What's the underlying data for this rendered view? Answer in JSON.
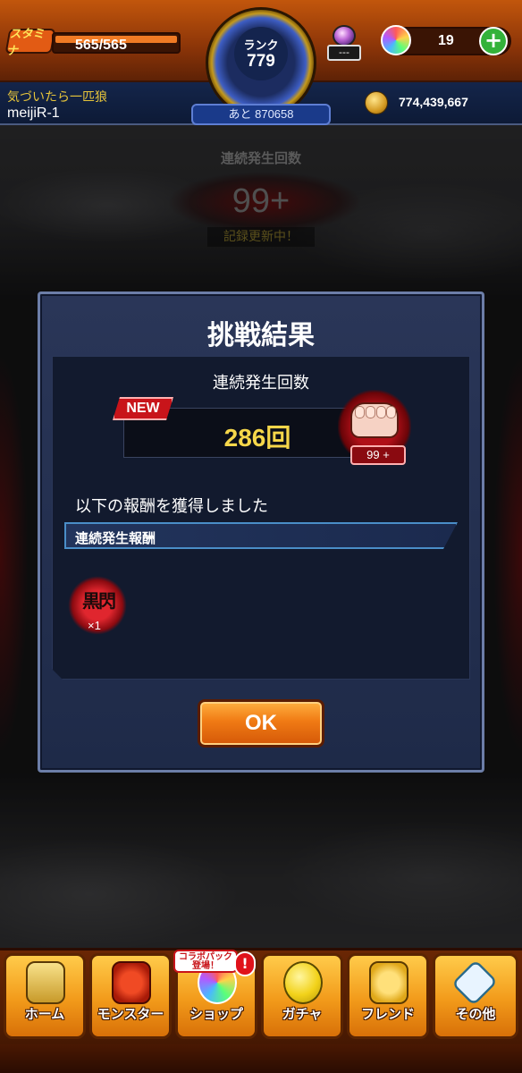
{
  "header": {
    "stamina_label": "スタミナ",
    "stamina_value": "565/565",
    "rank_label": "ランク",
    "rank_value": "779",
    "rank_remaining": "あと 870658",
    "potion_value": "---",
    "orb_count": "19",
    "player_title": "気づいたら一匹狼",
    "player_name": "meijiR-1",
    "coins": "774,439,667"
  },
  "background_counter": {
    "label": "連続発生回数",
    "value": "99+",
    "status": "記録更新中！"
  },
  "dialog": {
    "title": "挑戦結果",
    "heading": "連続発生回数",
    "new_badge": "NEW",
    "count": "286回",
    "badge_count": "99 +",
    "reward_text": "以下の報酬を獲得しました",
    "reward_category": "連続発生報酬",
    "reward_item_glyph": "黒閃",
    "reward_quantity": "×1",
    "ok_label": "OK"
  },
  "bottom_nav": {
    "items": [
      {
        "label": "ホーム",
        "icon": "home-icon"
      },
      {
        "label": "モンスター",
        "icon": "monster-icon"
      },
      {
        "label": "ショップ",
        "icon": "shop-icon"
      },
      {
        "label": "ガチャ",
        "icon": "gacha-icon"
      },
      {
        "label": "フレンド",
        "icon": "friend-icon"
      },
      {
        "label": "その他",
        "icon": "other-icon"
      }
    ],
    "shop_callout": "コラボパック 登場！",
    "shop_alert": "!"
  },
  "colors": {
    "accent_orange": "#f07a14",
    "count_yellow": "#f6d74a",
    "badge_red": "#c8141a",
    "dialog_navy": "#1e2a48"
  }
}
